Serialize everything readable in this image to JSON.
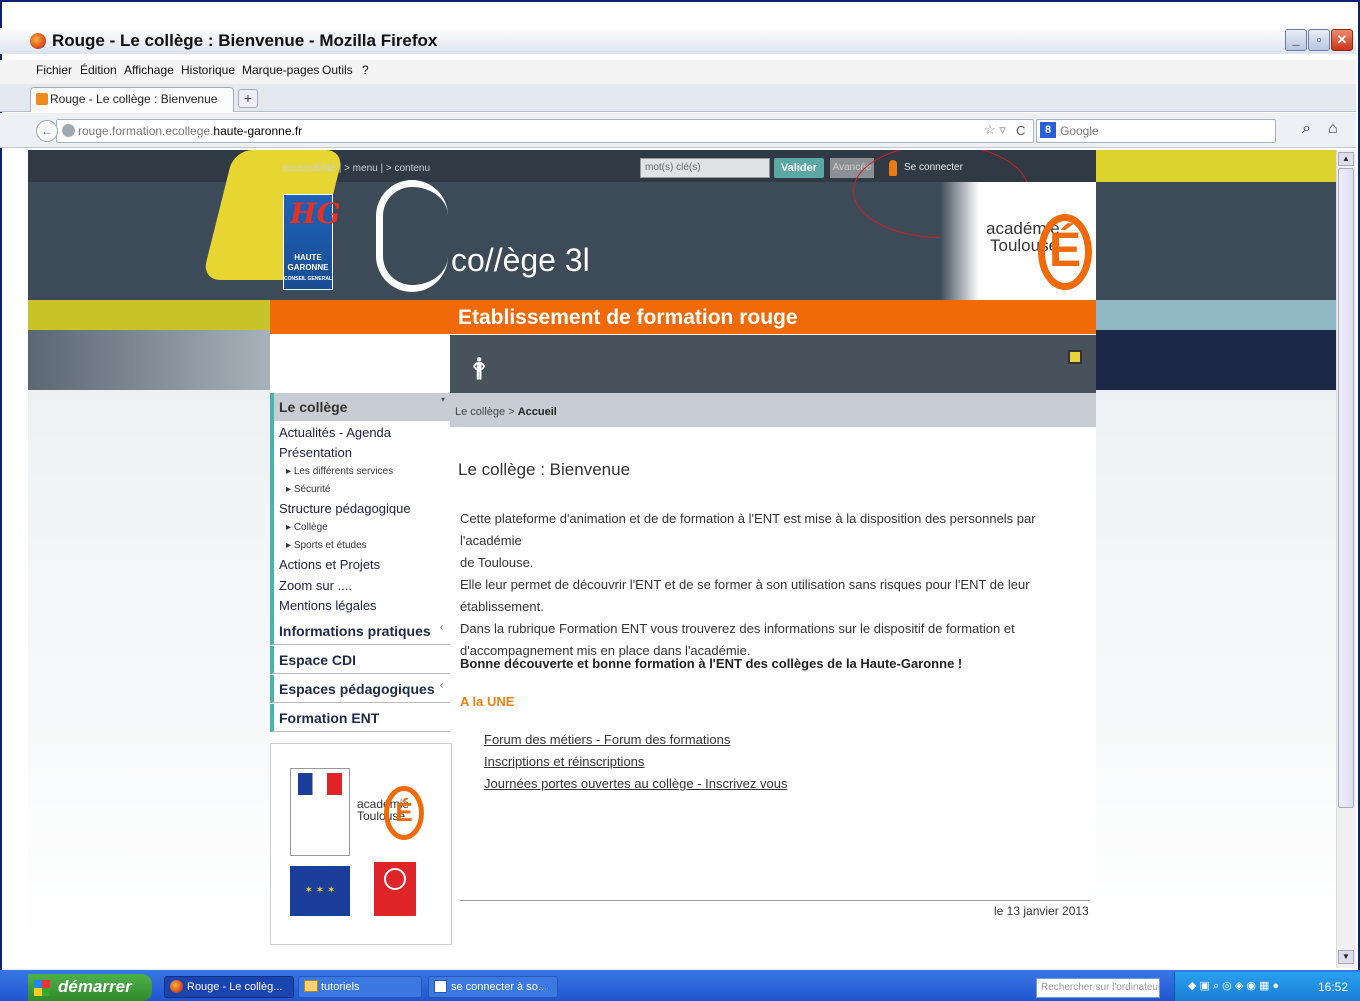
{
  "window": {
    "title": "Rouge - Le collège : Bienvenue - Mozilla Firefox"
  },
  "menu": [
    "Fichier",
    "Édition",
    "Affichage",
    "Historique",
    "Marque-pages",
    "Outils",
    "?"
  ],
  "tab": {
    "label": "Rouge - Le collège : Bienvenue"
  },
  "url": {
    "prefix": "rouge.formation.ecollege.",
    "domain": "haute-garonne.fr"
  },
  "search": {
    "placeholder": "Google"
  },
  "header": {
    "top_links": "accessibilité | > menu | > contenu",
    "search_placeholder": "mot(s) clé(s)",
    "valider": "Valider",
    "avancee": "Avancée",
    "connect": "Se connecter",
    "hg_line1": "HAUTE",
    "hg_line2": "GARONNE",
    "hg_line3": "CONSEIL GENERAL",
    "college31": "co//ège 3l",
    "academie": "académie",
    "toulouse": "Toulouse"
  },
  "page": {
    "banner": "Etablissement de formation rouge"
  },
  "breadcrumb": {
    "parent": "Le collège",
    "current": "Accueil"
  },
  "sidebar": {
    "section0": {
      "label": "Le collège",
      "items": [
        "Actualités - Agenda",
        "Présentation",
        "Les différents services",
        "Sécurité",
        "Structure pédagogique",
        "Collège",
        "Sports et études",
        "Actions et Projets",
        "Zoom sur ....",
        "Mentions légales"
      ]
    },
    "sections": [
      "Informations pratiques",
      "Espace CDI",
      "Espaces pédagogiques",
      "Formation ENT"
    ]
  },
  "content": {
    "title": "Le collège : Bienvenue",
    "paragraph_lines": [
      "Cette plateforme d'animation et de de formation à l'ENT est mise à la disposition des personnels par l'académie",
      "de Toulouse.",
      "Elle leur permet de découvrir l'ENT et de se former à son utilisation sans risques pour l'ENT de leur",
      "établissement.",
      "Dans la rubrique Formation ENT vous trouverez des informations sur le dispositif de formation et",
      "d'accompagnement mis en place dans l'académie."
    ],
    "bold_line": "Bonne découverte et bonne formation à l'ENT des collèges de la Haute-Garonne !",
    "une_heading": "A la UNE",
    "links": [
      "Forum des métiers - Forum des formations",
      "Inscriptions et réinscriptions",
      "Journées portes ouvertes au collège - Inscrivez vous"
    ],
    "date": "le 13 janvier 2013"
  },
  "taskbar": {
    "start": "démarrer",
    "items": [
      "Rouge - Le collèg...",
      "tutoriels",
      "se connecter à so..."
    ],
    "search_placeholder": "Rechercher sur l'ordinateur",
    "clock": "16:52"
  },
  "colors": {
    "accent_orange": "#f06a0a",
    "teal": "#4bb2ae",
    "header_dark": "#3d4a57",
    "annotation_red": "#d21e1e"
  }
}
